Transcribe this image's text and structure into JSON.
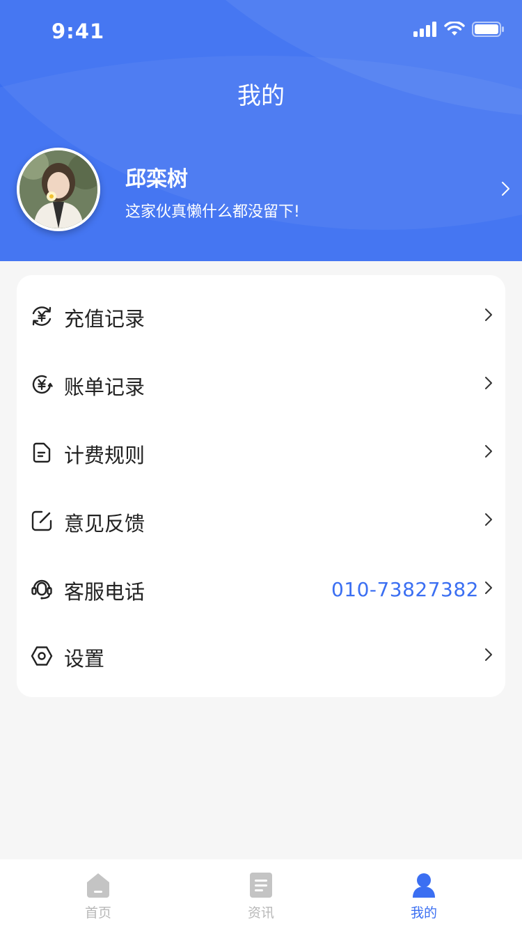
{
  "status_bar": {
    "time": "9:41"
  },
  "page": {
    "title": "我的"
  },
  "profile": {
    "name": "邱栾树",
    "bio": "这家伙真懒什么都没留下!"
  },
  "menu": {
    "items": [
      {
        "label": "充值记录",
        "icon": "recharge-yuan-icon"
      },
      {
        "label": "账单记录",
        "icon": "bill-yuan-icon"
      },
      {
        "label": "计费规则",
        "icon": "document-icon"
      },
      {
        "label": "意见反馈",
        "icon": "edit-feedback-icon"
      },
      {
        "label": "客服电话",
        "icon": "headset-icon",
        "value": "010-73827382"
      },
      {
        "label": "设置",
        "icon": "settings-hexagon-icon"
      }
    ]
  },
  "tabbar": {
    "tabs": [
      {
        "label": "首页",
        "icon": "home-icon",
        "active": false
      },
      {
        "label": "资讯",
        "icon": "news-icon",
        "active": false
      },
      {
        "label": "我的",
        "icon": "user-icon",
        "active": true
      }
    ]
  },
  "colors": {
    "accent": "#3b6ff2",
    "background": "#f6f6f6",
    "inactive_tab": "#b8b8b8"
  }
}
